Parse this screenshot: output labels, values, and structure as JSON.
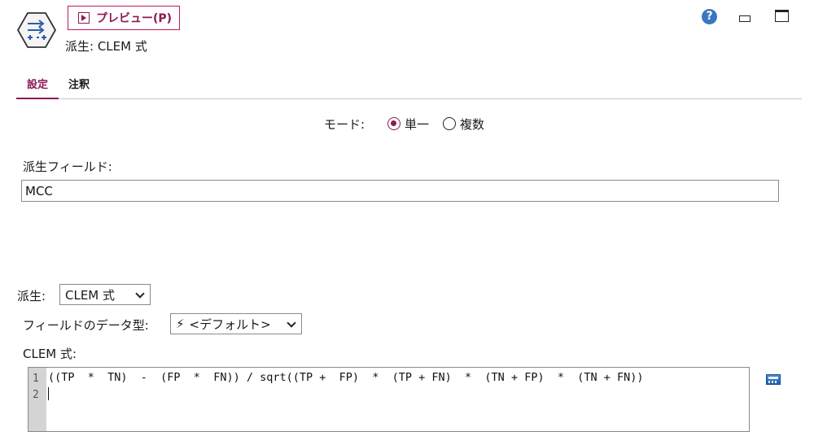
{
  "header": {
    "preview_label": "プレビュー(P)",
    "title": "派生: CLEM 式",
    "help_glyph": "?"
  },
  "tabs": [
    {
      "label": "設定",
      "active": true
    },
    {
      "label": "注釈",
      "active": false
    }
  ],
  "mode": {
    "label": "モード:",
    "options": [
      {
        "label": "単一",
        "selected": true
      },
      {
        "label": "複数",
        "selected": false
      }
    ]
  },
  "derive_field": {
    "label": "派生フィールド:",
    "value": "MCC"
  },
  "derive_as": {
    "label": "派生:",
    "value": "CLEM 式"
  },
  "field_type": {
    "label": "フィールドのデータ型:",
    "value": "<デフォルト>"
  },
  "clem": {
    "label": "CLEM 式:",
    "lines": [
      "((TP  *  TN)  -  (FP  *  FN)) / sqrt((TP +  FP)  *  (TP + FN)  *  (TN + FP)  *  (TN + FN))",
      ""
    ],
    "line_numbers": [
      "1",
      "2"
    ]
  },
  "colors": {
    "accent": "#8c1a55",
    "help": "#3b77c0"
  },
  "icons": [
    "derive-node-icon",
    "play-icon",
    "help-icon",
    "minimize-icon",
    "maximize-icon",
    "lightning-icon",
    "chevron-down-icon",
    "expression-builder-icon"
  ]
}
